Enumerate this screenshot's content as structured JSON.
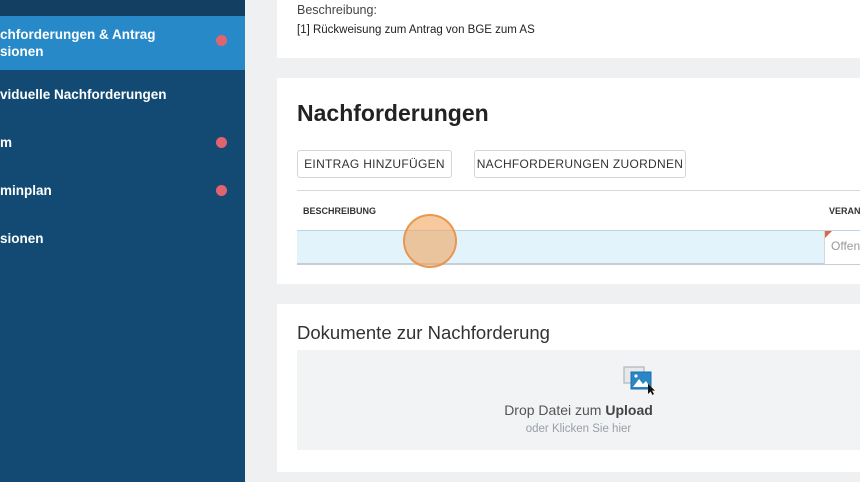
{
  "sidebar": {
    "items": [
      {
        "label_line1": "chforderungen & Antrag",
        "label_line2": "sionen",
        "active": true,
        "has_alert": true
      },
      {
        "label": "viduelle Nachforderungen",
        "active": false,
        "has_alert": false
      },
      {
        "label": "m",
        "active": false,
        "has_alert": true
      },
      {
        "label": "minplan",
        "active": false,
        "has_alert": true
      },
      {
        "label": "sionen",
        "active": false,
        "has_alert": false
      }
    ],
    "alert_color": "#e06470",
    "bg_color": "#134a73",
    "active_color": "#2889c8"
  },
  "description_panel": {
    "label": "Beschreibung:",
    "text": "[1] Rückweisung zum Antrag von BGE zum AS"
  },
  "nachforderungen": {
    "title": "Nachforderungen",
    "buttons": {
      "add": "EINTRAG HINZUFÜGEN",
      "assign": "NACHFORDERUNGEN ZUORDNEN"
    },
    "table": {
      "columns": [
        "BESCHREIBUNG",
        "VERAN"
      ],
      "rows": [
        {
          "beschreibung": "",
          "status": "Offen"
        }
      ]
    }
  },
  "dokumente": {
    "title": "Dokumente zur Nachforderung",
    "drop_prefix": "Drop Datei zum ",
    "drop_bold": "Upload",
    "drop_hint": "oder Klicken Sie hier",
    "icon": "image-upload-icon"
  }
}
